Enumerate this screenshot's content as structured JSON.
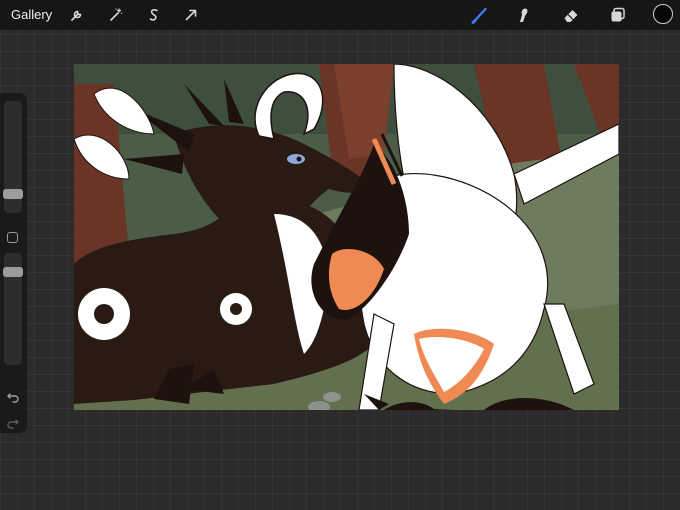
{
  "topbar": {
    "gallery_label": "Gallery",
    "left_tools": [
      "wrench-icon",
      "magic-wand-icon",
      "selection-s-icon",
      "transform-arrow-icon"
    ],
    "right_tools": [
      "brush-icon",
      "smudge-icon",
      "eraser-icon",
      "layers-icon"
    ],
    "active_tool": "brush",
    "accent_color": "#3d7cf0",
    "current_color": "#050505"
  },
  "sidebar": {
    "brush_size_level": 0.55,
    "opacity_level": 0.45,
    "controls": [
      "brush-size-slider",
      "modify-button",
      "opacity-slider",
      "undo-icon",
      "redo-icon"
    ]
  },
  "artwork": {
    "description_colors": {
      "sky_background": "#4b5c47",
      "ground": "#6e7b5e",
      "trees": "#6a3526",
      "dark_creature": "#2a1a14",
      "white_creature": "#ffffff",
      "accent_orange": "#f08a55",
      "stones": "#8e928e"
    }
  }
}
